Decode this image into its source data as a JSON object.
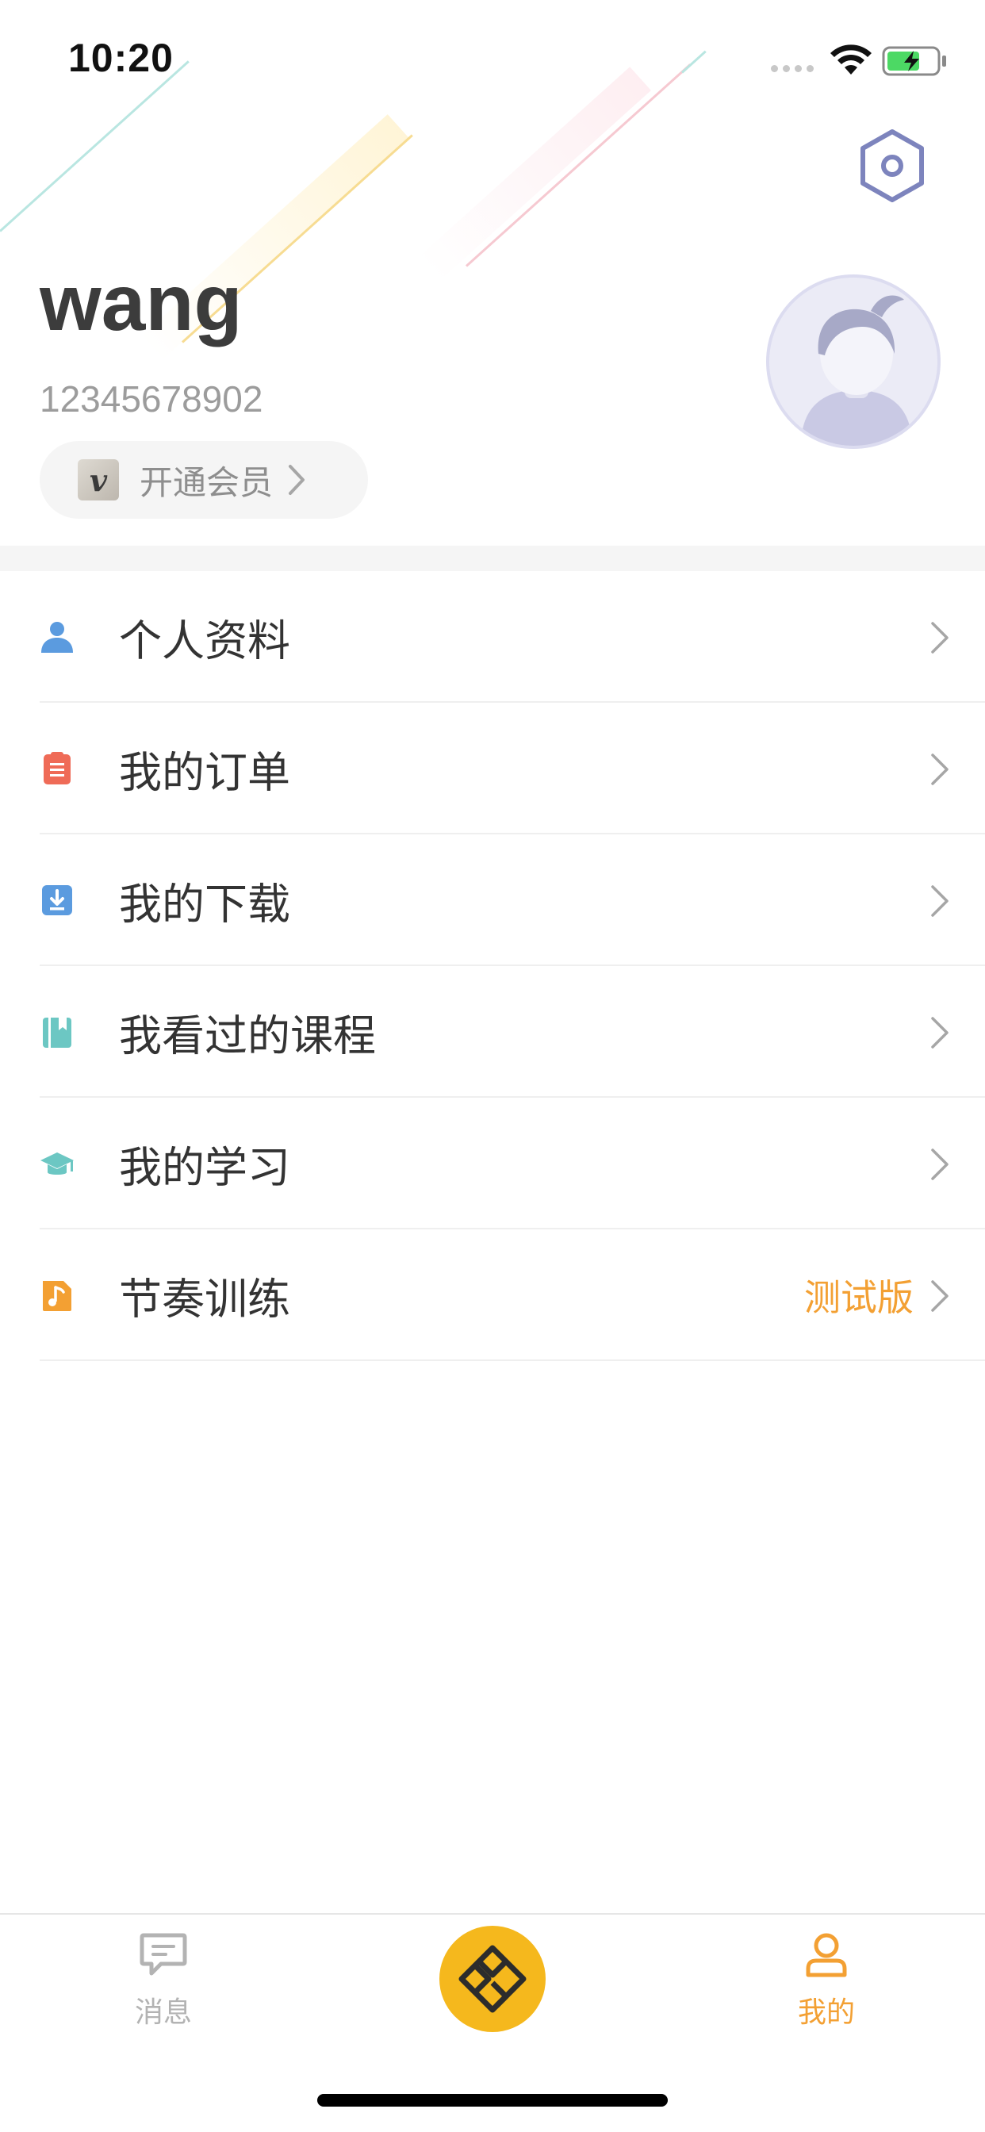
{
  "status_bar": {
    "time": "10:20"
  },
  "profile": {
    "username": "wang",
    "phone": "12345678902",
    "vip_badge_letter": "v",
    "vip_label": "开通会员"
  },
  "menu": {
    "items": [
      {
        "label": "个人资料",
        "icon": "person-icon",
        "color": "#5b9bdf"
      },
      {
        "label": "我的订单",
        "icon": "clipboard-icon",
        "color": "#ef6b57"
      },
      {
        "label": "我的下载",
        "icon": "download-icon",
        "color": "#5b9bdf"
      },
      {
        "label": "我看过的课程",
        "icon": "book-icon",
        "color": "#6cc7c3"
      },
      {
        "label": "我的学习",
        "icon": "graduation-cap-icon",
        "color": "#6cc7c3"
      },
      {
        "label": "节奏训练",
        "icon": "music-note-icon",
        "color": "#f3a033",
        "badge": "测试版"
      }
    ]
  },
  "tabbar": {
    "tabs": [
      {
        "label": "消息",
        "icon": "message-icon",
        "active": false
      },
      {
        "label": "",
        "icon": "app-logo-icon",
        "active": false
      },
      {
        "label": "我的",
        "icon": "user-icon",
        "active": true
      }
    ]
  },
  "colors": {
    "accent_orange": "#f3a033",
    "center_tab_yellow": "#f5b81d",
    "inactive_gray": "#b3b3b3"
  }
}
